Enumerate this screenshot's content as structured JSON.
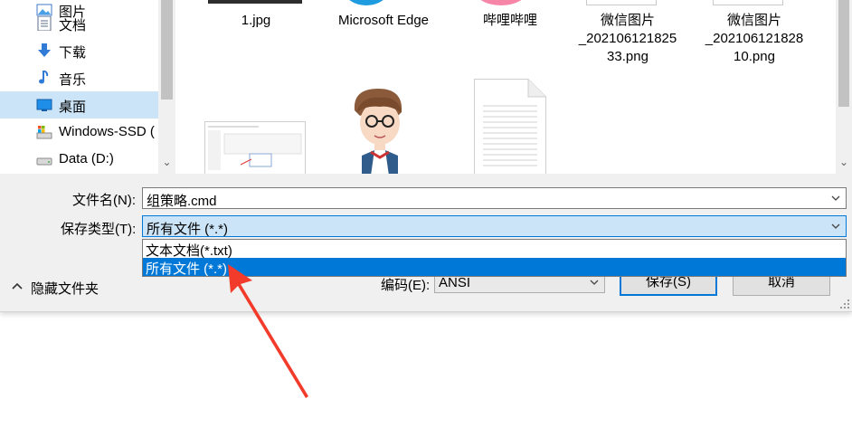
{
  "nav": {
    "items": [
      {
        "label": "图片",
        "icon": "pictures-icon"
      },
      {
        "label": "文档",
        "icon": "documents-icon"
      },
      {
        "label": "下载",
        "icon": "download-icon"
      },
      {
        "label": "音乐",
        "icon": "music-icon"
      },
      {
        "label": "桌面",
        "icon": "desktop-icon",
        "selected": true
      },
      {
        "label": "Windows-SSD (",
        "icon": "windows-drive-icon"
      },
      {
        "label": "Data (D:)",
        "icon": "drive-icon"
      }
    ]
  },
  "files": {
    "items": [
      {
        "line1": "1.jpg",
        "line2": "",
        "line3": ""
      },
      {
        "line1": "Microsoft Edge",
        "line2": "",
        "line3": ""
      },
      {
        "line1": "哔哩哔哩",
        "line2": "",
        "line3": ""
      },
      {
        "line1": "微信图片",
        "line2": "_202106121825",
        "line3": "33.png"
      },
      {
        "line1": "微信图片",
        "line2": "_202106121828",
        "line3": "10.png"
      }
    ]
  },
  "form": {
    "filename_label": "文件名(N):",
    "filename_value": "组策略.cmd",
    "filetype_label": "保存类型(T):",
    "filetype_value": "所有文件  (*.*)",
    "filetype_options": [
      "文本文档(*.txt)",
      "所有文件  (*.*)"
    ],
    "filetype_selected_index": 1,
    "encoding_label": "编码(E):",
    "encoding_value": "ANSI"
  },
  "footer": {
    "hide_folders_label": "隐藏文件夹",
    "save_label": "保存(S)",
    "cancel_label": "取消"
  },
  "colors": {
    "selection": "#0078d7",
    "nav_selected": "#cce4f7",
    "annotation_arrow": "#f23b2a"
  }
}
